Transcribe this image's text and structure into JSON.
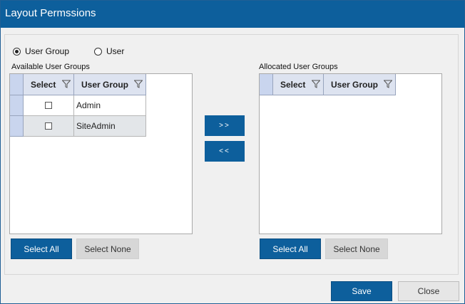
{
  "window": {
    "title": "Layout Permssions"
  },
  "mode": {
    "options": [
      {
        "label": "User Group",
        "selected": true
      },
      {
        "label": "User",
        "selected": false
      }
    ]
  },
  "available": {
    "label": "Available User Groups",
    "columns": [
      "Select",
      "User Group"
    ],
    "rows": [
      {
        "checked": false,
        "name": "Admin"
      },
      {
        "checked": false,
        "name": "SiteAdmin"
      }
    ],
    "select_all": "Select All",
    "select_none": "Select None"
  },
  "allocated": {
    "label": "Allocated User Groups",
    "columns": [
      "Select",
      "User Group"
    ],
    "rows": [],
    "select_all": "Select All",
    "select_none": "Select None"
  },
  "transfer": {
    "add": ">>",
    "remove": "<<"
  },
  "footer": {
    "save": "Save",
    "close": "Close"
  },
  "colors": {
    "primary": "#0d5f9c",
    "header_bg": "#dde3f0",
    "row_indicator": "#c9d5ee"
  }
}
